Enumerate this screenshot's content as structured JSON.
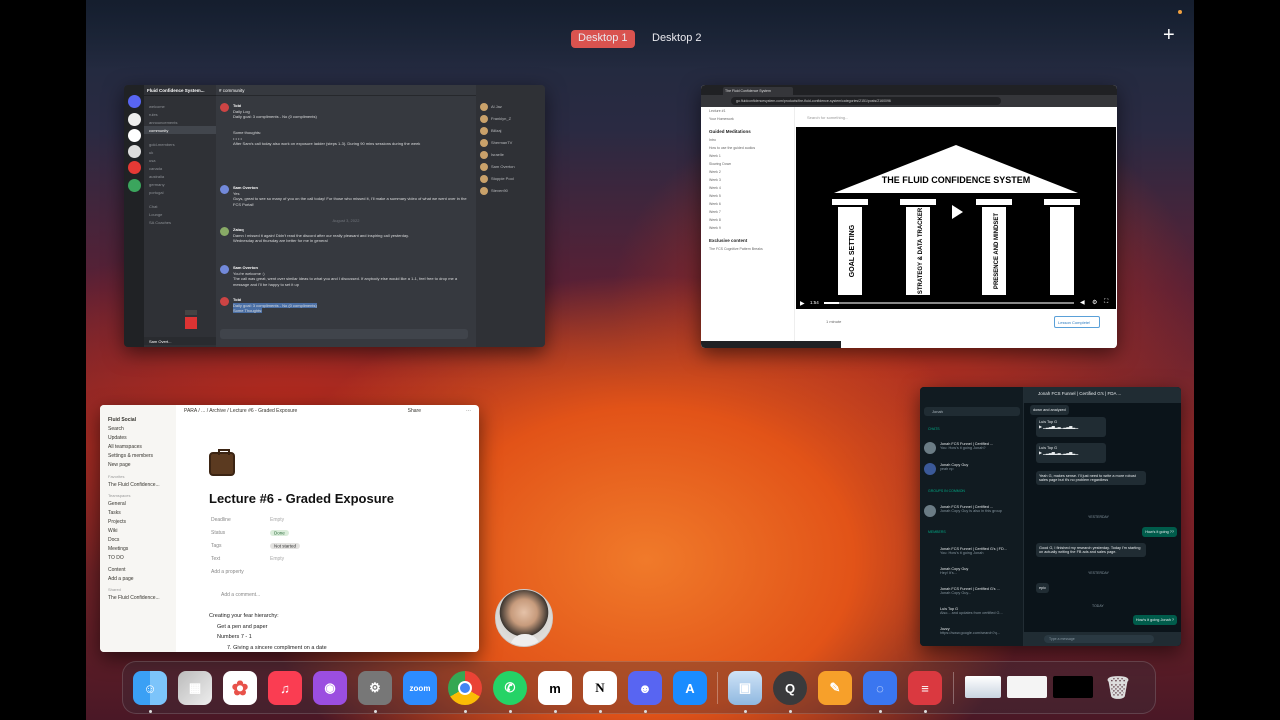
{
  "mission_control": {
    "desktops": [
      "Desktop 1",
      "Desktop 2"
    ],
    "active_desktop": "Desktop 1"
  },
  "discord": {
    "server_name": "Fluid Confidence System...",
    "channel_header": "# community",
    "channels": [
      "welcome",
      "rules",
      "announcements",
      "community",
      "gold-members",
      "uk",
      "usa",
      "canada",
      "australia",
      "germany",
      "portugal",
      "Chat",
      "Lounge",
      "SA Coaches"
    ],
    "selected_channel": "community",
    "messages": [
      {
        "author": "Tobi",
        "text": "Daily Log",
        "detail": "Daily goal: 3 compliments - No (0 compliments)"
      },
      {
        "author": "Tobi",
        "text": "Some thoughts:",
        "detail": "After Sam's call today also work on exposure ladder (steps 1-3). During 90 mins sessions during the week"
      },
      {
        "author": "Sam Overton",
        "text": "Yes",
        "detail": "Guys, great to see so many of you on the call today! For those who missed it, I'll make a summary video of what we went over in the FCS Portal!"
      },
      {
        "author": "Tobi",
        "text": "Damn I missed it again! Didn't read the discord after our really pleasant and inspiring call yesterday.",
        "detail": "Wednesday and thursday are better for me in general"
      },
      {
        "author": "Sam Overton",
        "text": "You're welcome :)",
        "detail": "The call was great, went over similar ideas to what you and I discussed. If anybody else would like a 1-1, feel free to drop me a message and I'll be happy to set it up"
      },
      {
        "author": "Tobi",
        "text": "Daily goal: 3 compliments - No (0 compliments)",
        "detail": "Some Thoughts:"
      }
    ],
    "date_divider": "August 3, 2022",
    "members": [
      "Al Jaz",
      "Franklyn_Z",
      "Billzaj",
      "ShermanTV",
      "Israelle",
      "Sam Overton",
      "Stoppie Pool",
      "Steven90"
    ],
    "user": "Sam Overt..."
  },
  "browser": {
    "tab_title": "The Fluid Confidence System",
    "url": "go.fluidconfidencesystem.com/products/the-fluid-confidence-system/categories/2151/posts/2160096",
    "search_placeholder": "Search for something...",
    "sidebar": [
      "Lecture #1",
      "Your Homework",
      "Guided Meditations",
      "Intro",
      "How to use the guided audios",
      "Week 1",
      "Slowing Down",
      "Week 2",
      "Week 3",
      "Week 4",
      "Week 5",
      "Week 6",
      "Week 7",
      "Week 8",
      "Week 9",
      "Exclusive content",
      "The FCS Cognitive Pattern Breaks"
    ],
    "video_title": "THE FLUID CONFIDENCE SYSTEM",
    "pillars": [
      "GOAL SETTING",
      "STRATEGY & DATA TRACKER",
      "PRESENCE AND MINDSET"
    ],
    "time": "1:54",
    "footer_comments": "1 minute",
    "complete_button": "Lesson Complete!"
  },
  "notion": {
    "workspace": "Fluid Social",
    "nav": [
      "Search",
      "Updates",
      "All teamspaces",
      "Settings & members",
      "New page"
    ],
    "favorites_label": "Favorites",
    "favorite_item": "The Fluid Confidence...",
    "teamspaces_label": "Teamspaces",
    "teamspaces": [
      "General",
      "Tasks",
      "Projects",
      "Wiki",
      "Docs",
      "Meetings",
      "TO DO"
    ],
    "extra": [
      "Content",
      "Add a page"
    ],
    "shared_label": "Shared",
    "shared_item": "The Fluid Confidence...",
    "breadcrumb": "PARA / ... / Archive / Lecture #6 - Graded Exposure",
    "share": "Share",
    "title": "Lecture #6 - Graded Exposure",
    "props": [
      {
        "name": "Deadline",
        "value": "Empty"
      },
      {
        "name": "Status",
        "value": "Done"
      },
      {
        "name": "Tags",
        "value": "Not started"
      },
      {
        "name": "Text",
        "value": "Empty"
      }
    ],
    "add_property": "Add a property",
    "add_comment": "Add a comment...",
    "body": [
      "Creating your fear hierarchy:",
      "Get a pen and paper",
      "Numbers 7 - 1",
      "7. Giving a sincere compliment on a date"
    ]
  },
  "whatsapp": {
    "search": "Jonah",
    "chats_label": "CHATS",
    "groups_label": "GROUPS IN COMMON",
    "members_label": "MEMBERS",
    "list": [
      {
        "name": "Jonah FCS Funnel | Certified ...",
        "msg": "You: How's it going Jonah?"
      },
      {
        "name": "Jonah Copy Guy",
        "msg": "yeah np"
      },
      {
        "name": "Jonah FCS Funnel | Certified ...",
        "msg": "Jonah Copy Guy is also in this group"
      },
      {
        "name": "Jonah FCS Funnel | Certified G's | FD...",
        "msg": "You: How's it going Jonah"
      },
      {
        "name": "Jonah Copy Guy",
        "msg": "Hey! It's..."
      },
      {
        "name": "Jonah FCS Funnel | Certified G's ...",
        "msg": "Jonah Copy Guy..."
      },
      {
        "name": "Luis Top G",
        "msg": "Also... and updates from certified G..."
      },
      {
        "name": "Jozzy",
        "msg": "https://www.google.com/search?q..."
      }
    ],
    "chat_title": "Jonah FCS Funnel | Certified G's | FDA ...",
    "messages": [
      {
        "dir": "in",
        "text": "down and analyzed"
      },
      {
        "dir": "in",
        "text": "Luis Top G"
      },
      {
        "dir": "in",
        "text": "Luis Top G"
      },
      {
        "dir": "in",
        "text": "Yeah G, makes sense. I'll just need to write a more robust sales page but it's no problem regardless"
      },
      {
        "dir": "out",
        "text": "How's it going ??"
      },
      {
        "dir": "in",
        "text": "Good G, I finished my research yesterday. Today I'm starting on actually writing the FB ads and sales page."
      },
      {
        "dir": "in",
        "text": "epic"
      },
      {
        "dir": "out",
        "text": "How's it going Jonah ?"
      }
    ],
    "dividers": [
      "YESTERDAY",
      "TODAY"
    ],
    "compose_placeholder": "Type a message"
  },
  "dock": {
    "apps": [
      "Finder",
      "Launchpad",
      "Photos",
      "Music",
      "Podcasts",
      "System Settings",
      "Zoom",
      "Chrome",
      "WhatsApp",
      "Mem",
      "Notion",
      "Discord",
      "App Store",
      "Preview",
      "QuickTime",
      "Pages",
      "Signal",
      "Expressvpn",
      "Trash"
    ],
    "zoom_label": "zoom",
    "notion_label": "N"
  },
  "colors": {
    "desktop_active": "#d9534f",
    "discord_bg": "#36393f",
    "whatsapp_bg": "#111b21",
    "accent_blue": "#2a7bc0"
  }
}
